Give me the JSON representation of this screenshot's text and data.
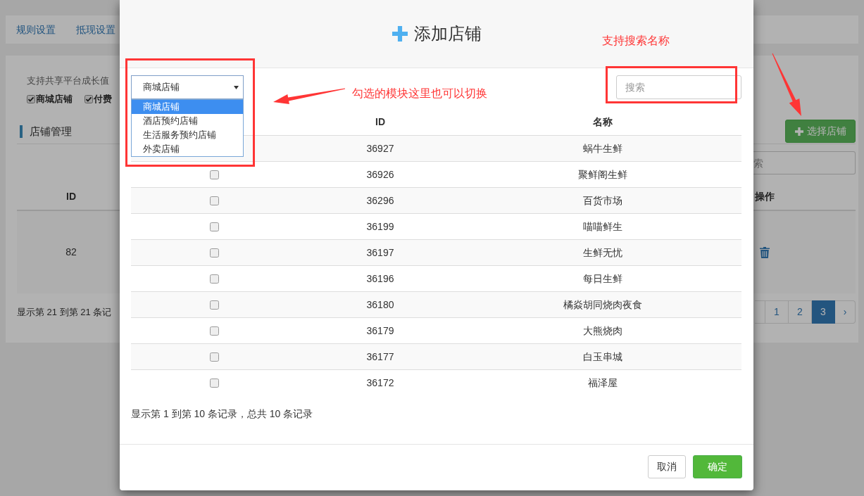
{
  "background_page": {
    "nav_links": [
      "规则设置",
      "抵现设置"
    ],
    "note": "支持共享平台成长值",
    "options": [
      {
        "label": "商城店铺",
        "checked": true
      },
      {
        "label": "付费",
        "checked": true
      }
    ],
    "section_title": "店铺管理",
    "select_button": "选择店铺",
    "search": {
      "placeholder": "索"
    },
    "table": {
      "columns": [
        "ID",
        "操作"
      ],
      "rows": [
        {
          "id": "82"
        }
      ]
    },
    "summary": "显示第 21 到第 21 条记",
    "pagination": [
      {
        "label": "1",
        "selected": false
      },
      {
        "label": "2",
        "selected": false
      },
      {
        "label": "3",
        "selected": true
      },
      {
        "label": "›",
        "selected": false
      }
    ]
  },
  "modal": {
    "title": "添加店铺",
    "type_select": {
      "value": "商城店铺",
      "expanded": true,
      "options": [
        {
          "label": "商城店铺",
          "selected": true
        },
        {
          "label": "酒店预约店铺",
          "selected": false
        },
        {
          "label": "生活服务预约店铺",
          "selected": false
        },
        {
          "label": "外卖店铺",
          "selected": false
        }
      ]
    },
    "search": {
      "placeholder": "搜索"
    },
    "table": {
      "columns": [
        "ID",
        "名称"
      ],
      "rows": [
        {
          "id": "36927",
          "name": "蜗牛生鲜"
        },
        {
          "checked": false,
          "id": "36926",
          "name": "聚鲜阁生鲜"
        },
        {
          "checked": false,
          "id": "36296",
          "name": "百货市场"
        },
        {
          "checked": false,
          "id": "36199",
          "name": "喵喵鲜生"
        },
        {
          "checked": false,
          "id": "36197",
          "name": "生鲜无忧"
        },
        {
          "checked": false,
          "id": "36196",
          "name": "每日生鲜"
        },
        {
          "checked": false,
          "id": "36180",
          "name": "橘焱胡同烧肉夜食"
        },
        {
          "checked": false,
          "id": "36179",
          "name": "大熊烧肉"
        },
        {
          "checked": false,
          "id": "36177",
          "name": "白玉串城"
        },
        {
          "checked": false,
          "id": "36172",
          "name": "福泽屋"
        }
      ]
    },
    "summary": "显示第 1 到第 10 条记录，总共 10 条记录",
    "buttons": [
      {
        "label": "取消",
        "kind": "default"
      },
      {
        "label": "确定",
        "kind": "primary"
      }
    ]
  },
  "annotations": [
    {
      "text": "勾选的模块这里也可以切换"
    },
    {
      "text": "支持搜索名称"
    }
  ]
}
